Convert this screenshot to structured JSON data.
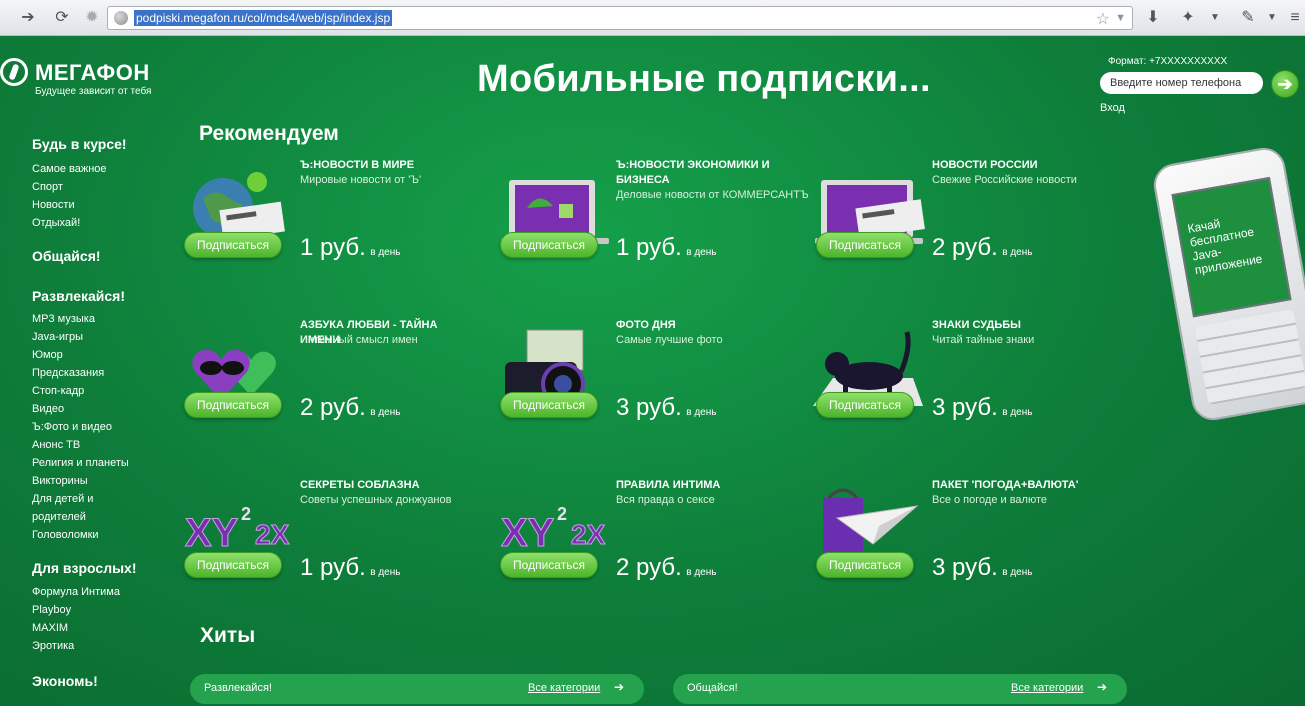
{
  "browser": {
    "url": "podpiski.megafon.ru/col/mds4/web/jsp/index.jsp"
  },
  "header": {
    "logo_name": "МегаФон",
    "logo_slogan": "Будущее зависит от тебя",
    "title": "Мобильные подписки...",
    "login": {
      "format_label": "Формат: +7XXXXXXXXXX",
      "phone_placeholder": "Введите номер телефона",
      "enter_label": "Вход"
    }
  },
  "sidebar": {
    "groups": [
      {
        "title": "Будь в курсе!",
        "links": [
          "Самое важное",
          "Спорт",
          "Новости",
          "Отдыхай!"
        ]
      },
      {
        "title": "Общайся!",
        "links": []
      },
      {
        "title": "Развлекайся!",
        "links": [
          "MP3 музыка",
          "Java-игры",
          "Юмор",
          "Предсказания",
          "Стоп-кадр",
          "Видео",
          "Ъ:Фото и видео",
          "Анонс ТВ",
          "Религия и планеты",
          "Викторины",
          "Для детей и",
          "родителей",
          "Головоломки"
        ]
      },
      {
        "title": "Для взрослых!",
        "links": [
          "Формула Интима",
          "Playboy",
          "MAXIM",
          "Эротика"
        ]
      },
      {
        "title": "Экономь!",
        "links": []
      }
    ]
  },
  "recommended": {
    "heading": "Рекомендуем",
    "subscribe_label": "Подписаться",
    "per_day": "в день",
    "items": [
      {
        "title": "Ъ:НОВОСТИ В МИРЕ",
        "desc": "Мировые новости от 'Ъ'",
        "price": "1 руб.",
        "icon": "world-news-icon"
      },
      {
        "title": "Ъ:НОВОСТИ ЭКОНОМИКИ И БИЗНЕСА",
        "desc": "Деловые новости от КОММЕРСАНТЪ",
        "price": "1 руб.",
        "icon": "business-news-icon"
      },
      {
        "title": "НОВОСТИ РОССИИ",
        "desc": "Свежие Российские новости",
        "price": "2 руб.",
        "icon": "russia-news-icon"
      },
      {
        "title": "АЗБУКА ЛЮБВИ - ТАЙНА ИМЕНИ",
        "desc": "Интимный смысл имен",
        "price": "2 руб.",
        "icon": "hearts-icon"
      },
      {
        "title": "ФОТО ДНЯ",
        "desc": "Самые лучшие фото",
        "price": "3 руб.",
        "icon": "camera-icon"
      },
      {
        "title": "ЗНАКИ СУДЬБЫ",
        "desc": "Читай тайные знаки",
        "price": "3 руб.",
        "icon": "black-cat-icon"
      },
      {
        "title": "СЕКРЕТЫ СОБЛАЗНА",
        "desc": "Советы успешных донжуанов",
        "price": "1 руб.",
        "icon": "formula-icon"
      },
      {
        "title": "ПРАВИЛА ИНТИМА",
        "desc": "Вся правда о сексе",
        "price": "2 руб.",
        "icon": "formula-icon"
      },
      {
        "title": "ПАКЕТ 'ПОГОДА+ВАЛЮТА'",
        "desc": "Все о погоде и валюте",
        "price": "3 руб.",
        "icon": "weather-currency-icon"
      }
    ]
  },
  "phone_ad": {
    "text": "Качай бесплатное Java-приложение"
  },
  "hits": {
    "heading": "Хиты",
    "bars": [
      {
        "label": "Развлекайся!",
        "link": "Все категории"
      },
      {
        "label": "Общайся!",
        "link": "Все категории"
      }
    ]
  }
}
